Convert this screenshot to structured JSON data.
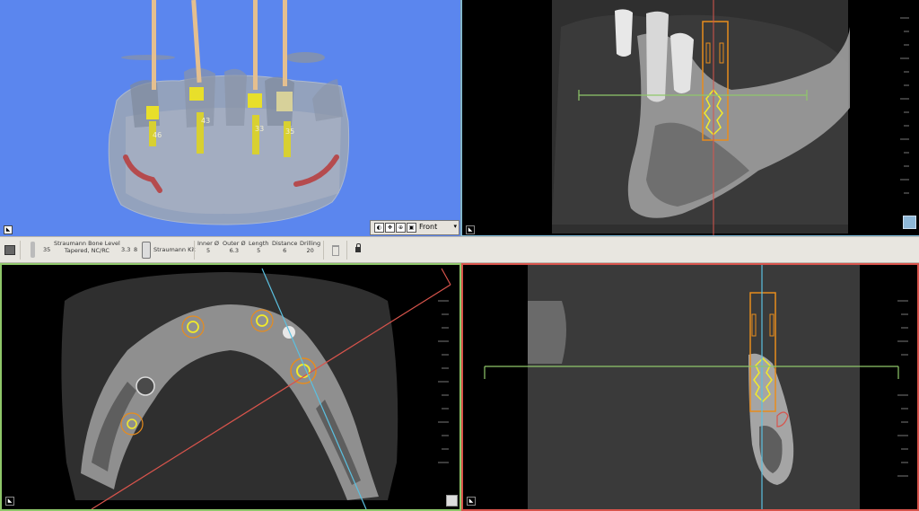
{
  "view3d": {
    "tooth_labels": [
      "46",
      "43",
      "33",
      "35"
    ],
    "view_selector": {
      "selected": "Front"
    },
    "background_color": "#5b86ee"
  },
  "toolbar": {
    "tooth_number": "35",
    "implant_name_line1": "Straumann Bone Level",
    "implant_name_line2": "Tapered, NC/RC",
    "diameter": "3.3",
    "length": "8",
    "kit_name": "Straumann Kit",
    "inner_label": "Inner Ø",
    "inner_value": "5",
    "outer_label": "Outer Ø",
    "outer_value": "6.3",
    "length_label": "Length",
    "length_value": "5",
    "distance_label": "Distance",
    "distance_value": "6",
    "drilling_label": "Drilling",
    "drilling_value": "20"
  },
  "icons": {
    "view_camera": "camera-icon",
    "implant": "implant-icon",
    "kit": "kit-canister-icon",
    "trash": "trash-icon",
    "lock": "lock-icon"
  },
  "colors": {
    "sagittal_border": "#7fbfdf",
    "axial_border": "#8fc76a",
    "cross_border": "#d8544c",
    "implant_outline": "#e88c1c",
    "implant_body": "#f2ea2a"
  }
}
